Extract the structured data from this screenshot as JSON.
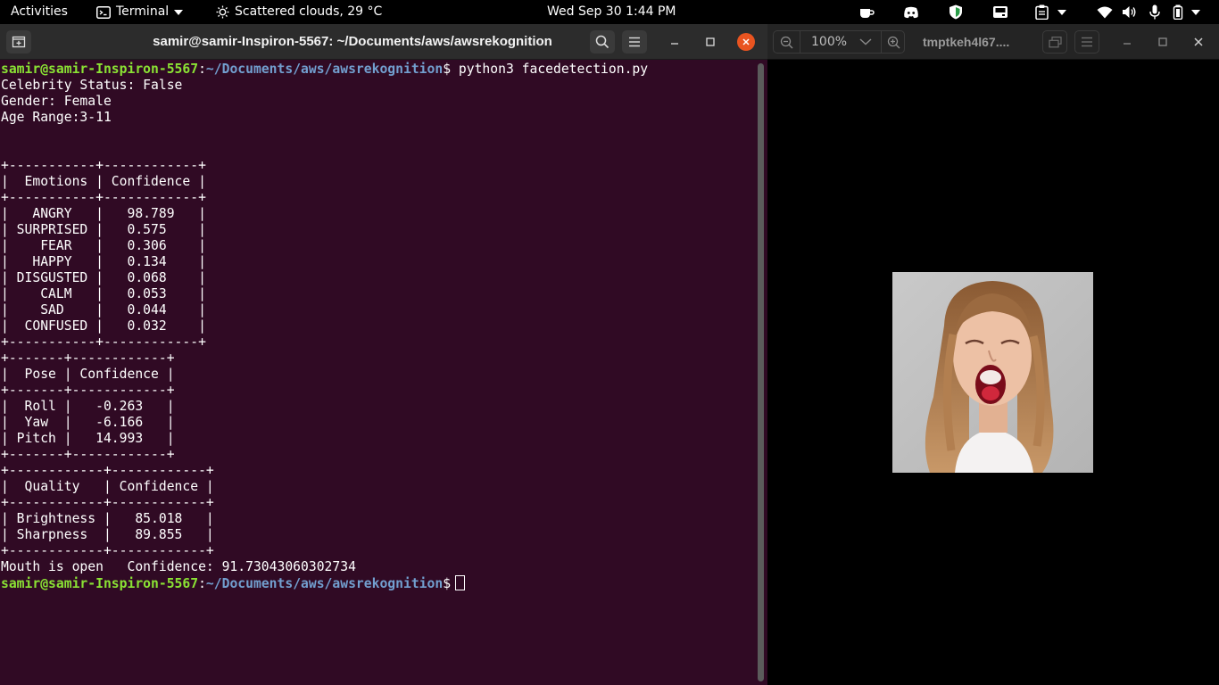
{
  "topbar": {
    "activities": "Activities",
    "app_name": "Terminal",
    "weather": "Scattered clouds, 29 °C",
    "clock": "Wed Sep 30  1:44 PM"
  },
  "terminal": {
    "title": "samir@samir-Inspiron-5567: ~/Documents/aws/awsrekognition",
    "prompt_user": "samir@samir-Inspiron-5567",
    "prompt_path": "~/Documents/aws/awsrekognition",
    "command": "python3 facedetection.py",
    "output_lines": [
      "Celebrity Status: False",
      "Gender: Female",
      "Age Range:3-11",
      "",
      "",
      "+-----------+------------+",
      "|  Emotions | Confidence |",
      "+-----------+------------+",
      "|   ANGRY   |   98.789   |",
      "| SURPRISED |   0.575    |",
      "|    FEAR   |   0.306    |",
      "|   HAPPY   |   0.134    |",
      "| DISGUSTED |   0.068    |",
      "|    CALM   |   0.053    |",
      "|    SAD    |   0.044    |",
      "|  CONFUSED |   0.032    |",
      "+-----------+------------+",
      "+-------+------------+",
      "|  Pose | Confidence |",
      "+-------+------------+",
      "|  Roll |   -0.263   |",
      "|  Yaw  |   -6.166   |",
      "| Pitch |   14.993   |",
      "+-------+------------+",
      "+------------+------------+",
      "|  Quality   | Confidence |",
      "+------------+------------+",
      "| Brightness |   85.018   |",
      "| Sharpness  |   89.855   |",
      "+------------+------------+",
      "Mouth is open   Confidence: 91.73043060302734"
    ]
  },
  "viewer": {
    "zoom": "100%",
    "title": "tmptkeh4l67...."
  }
}
